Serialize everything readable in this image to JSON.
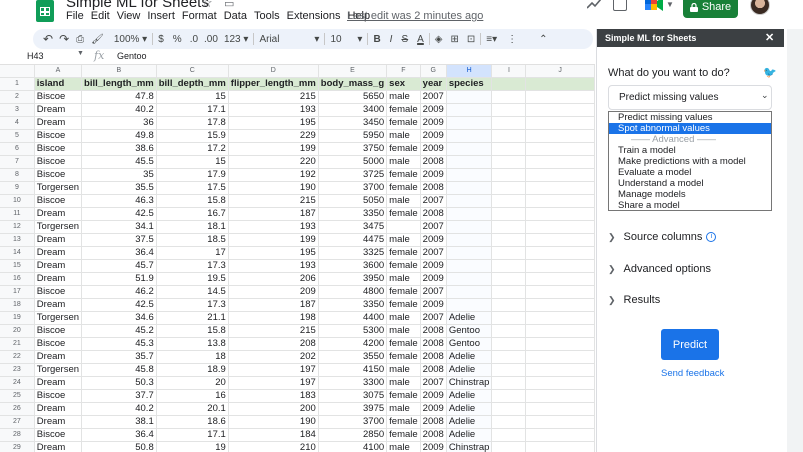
{
  "header": {
    "title": "Simple ML for Sheets",
    "menu": [
      "File",
      "Edit",
      "View",
      "Insert",
      "Format",
      "Data",
      "Tools",
      "Extensions",
      "Help"
    ],
    "last_edit": "Last edit was 2 minutes ago",
    "share_label": "Share"
  },
  "toolbar": {
    "zoom": "100%",
    "currency": "$",
    "percent": "%",
    "dec_decrease": ".0",
    "dec_increase": ".00",
    "number_format": "123",
    "font": "Arial",
    "font_size": "10",
    "bold": "B",
    "italic": "I",
    "strike": "S",
    "text_color": "A"
  },
  "formula_bar": {
    "cell_ref": "H43",
    "fx": "fx",
    "value": "Gentoo"
  },
  "grid": {
    "columns": [
      "A",
      "B",
      "C",
      "D",
      "E",
      "F",
      "G",
      "H",
      "I",
      "J"
    ],
    "rows": [
      {
        "n": "1",
        "cells": [
          "island",
          "bill_length_mm",
          "bill_depth_mm",
          "flipper_length_mm",
          "body_mass_g",
          "sex",
          "year",
          "species",
          "",
          ""
        ]
      },
      {
        "n": "2",
        "cells": [
          "Biscoe",
          "47.8",
          "15",
          "215",
          "5650",
          "male",
          "2007",
          "",
          "",
          ""
        ]
      },
      {
        "n": "3",
        "cells": [
          "Dream",
          "40.2",
          "17.1",
          "193",
          "3400",
          "female",
          "2009",
          "",
          "",
          ""
        ]
      },
      {
        "n": "4",
        "cells": [
          "Dream",
          "36",
          "17.8",
          "195",
          "3450",
          "female",
          "2009",
          "",
          "",
          ""
        ]
      },
      {
        "n": "5",
        "cells": [
          "Biscoe",
          "49.8",
          "15.9",
          "229",
          "5950",
          "male",
          "2009",
          "",
          "",
          ""
        ]
      },
      {
        "n": "6",
        "cells": [
          "Biscoe",
          "38.6",
          "17.2",
          "199",
          "3750",
          "female",
          "2009",
          "",
          "",
          ""
        ]
      },
      {
        "n": "7",
        "cells": [
          "Biscoe",
          "45.5",
          "15",
          "220",
          "5000",
          "male",
          "2008",
          "",
          "",
          ""
        ]
      },
      {
        "n": "8",
        "cells": [
          "Biscoe",
          "35",
          "17.9",
          "192",
          "3725",
          "female",
          "2009",
          "",
          "",
          ""
        ]
      },
      {
        "n": "9",
        "cells": [
          "Torgersen",
          "35.5",
          "17.5",
          "190",
          "3700",
          "female",
          "2008",
          "",
          "",
          ""
        ]
      },
      {
        "n": "10",
        "cells": [
          "Biscoe",
          "46.3",
          "15.8",
          "215",
          "5050",
          "male",
          "2007",
          "",
          "",
          ""
        ]
      },
      {
        "n": "11",
        "cells": [
          "Dream",
          "42.5",
          "16.7",
          "187",
          "3350",
          "female",
          "2008",
          "",
          "",
          ""
        ]
      },
      {
        "n": "12",
        "cells": [
          "Torgersen",
          "34.1",
          "18.1",
          "193",
          "3475",
          "",
          "2007",
          "",
          "",
          ""
        ]
      },
      {
        "n": "13",
        "cells": [
          "Dream",
          "37.5",
          "18.5",
          "199",
          "4475",
          "male",
          "2009",
          "",
          "",
          ""
        ]
      },
      {
        "n": "14",
        "cells": [
          "Dream",
          "36.4",
          "17",
          "195",
          "3325",
          "female",
          "2007",
          "",
          "",
          ""
        ]
      },
      {
        "n": "15",
        "cells": [
          "Dream",
          "45.7",
          "17.3",
          "193",
          "3600",
          "female",
          "2009",
          "",
          "",
          ""
        ]
      },
      {
        "n": "16",
        "cells": [
          "Dream",
          "51.9",
          "19.5",
          "206",
          "3950",
          "male",
          "2009",
          "",
          "",
          ""
        ]
      },
      {
        "n": "17",
        "cells": [
          "Biscoe",
          "46.2",
          "14.5",
          "209",
          "4800",
          "female",
          "2007",
          "",
          "",
          ""
        ]
      },
      {
        "n": "18",
        "cells": [
          "Dream",
          "42.5",
          "17.3",
          "187",
          "3350",
          "female",
          "2009",
          "",
          "",
          ""
        ]
      },
      {
        "n": "19",
        "cells": [
          "Torgersen",
          "34.6",
          "21.1",
          "198",
          "4400",
          "male",
          "2007",
          "Adelie",
          "",
          ""
        ]
      },
      {
        "n": "20",
        "cells": [
          "Biscoe",
          "45.2",
          "15.8",
          "215",
          "5300",
          "male",
          "2008",
          "Gentoo",
          "",
          ""
        ]
      },
      {
        "n": "21",
        "cells": [
          "Biscoe",
          "45.3",
          "13.8",
          "208",
          "4200",
          "female",
          "2008",
          "Gentoo",
          "",
          ""
        ]
      },
      {
        "n": "22",
        "cells": [
          "Dream",
          "35.7",
          "18",
          "202",
          "3550",
          "female",
          "2008",
          "Adelie",
          "",
          ""
        ]
      },
      {
        "n": "23",
        "cells": [
          "Torgersen",
          "45.8",
          "18.9",
          "197",
          "4150",
          "male",
          "2008",
          "Adelie",
          "",
          ""
        ]
      },
      {
        "n": "24",
        "cells": [
          "Dream",
          "50.3",
          "20",
          "197",
          "3300",
          "male",
          "2007",
          "Chinstrap",
          "",
          ""
        ]
      },
      {
        "n": "25",
        "cells": [
          "Biscoe",
          "37.7",
          "16",
          "183",
          "3075",
          "female",
          "2009",
          "Adelie",
          "",
          ""
        ]
      },
      {
        "n": "26",
        "cells": [
          "Dream",
          "40.2",
          "20.1",
          "200",
          "3975",
          "male",
          "2009",
          "Adelie",
          "",
          ""
        ]
      },
      {
        "n": "27",
        "cells": [
          "Dream",
          "38.1",
          "18.6",
          "190",
          "3700",
          "female",
          "2008",
          "Adelie",
          "",
          ""
        ]
      },
      {
        "n": "28",
        "cells": [
          "Biscoe",
          "36.4",
          "17.1",
          "184",
          "2850",
          "female",
          "2008",
          "Adelie",
          "",
          ""
        ]
      },
      {
        "n": "29",
        "cells": [
          "Dream",
          "50.8",
          "19",
          "210",
          "4100",
          "male",
          "2009",
          "Chinstrap",
          "",
          ""
        ]
      }
    ]
  },
  "panel": {
    "title": "Simple ML for Sheets",
    "question": "What do you want to do?",
    "selected_task": "Predict missing values",
    "options": [
      "Predict missing values",
      "Spot abnormal values",
      "—— Advanced ——",
      "Train a model",
      "Make predictions with a model",
      "Evaluate a model",
      "Understand a model",
      "Manage models",
      "Share a model"
    ],
    "sections": [
      "Source columns",
      "Advanced options",
      "Results"
    ],
    "predict_label": "Predict",
    "feedback_label": "Send feedback"
  },
  "colors": {
    "accent": "#1a73e8",
    "share": "#188038",
    "header_fill": "#d9ead3",
    "panel_header": "#3c4043"
  }
}
